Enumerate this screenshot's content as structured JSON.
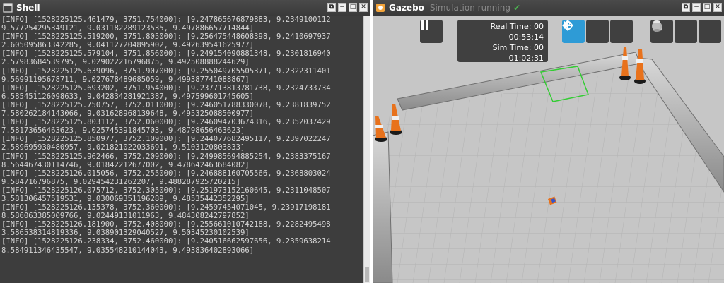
{
  "shell": {
    "title": "Shell",
    "lines": [
      "[INFO] [1528225125.461479, 3751.754000]: [9.247865676879883, 9.2349100112",
      "9.577254295349121, 9.031182289123535, 9.497886657714844]",
      "[INFO] [1528225125.519200, 3751.805000]: [9.256475448608398, 9.2410697937",
      "2.605095863342285, 9.041127204895902, 9.492639541625977]",
      "[INFO] [1528225125.579104, 3751.856000]: [9.249154090881348, 9.2301816940",
      "2.57983684539795, 9.029022216796875, 9.492508888244629]",
      "[INFO] [1528225125.639096, 3751.907000]: [9.255049705505371, 9.2322311401",
      "9.56991195678711, 9.027678489685059, 9.499387741088867]",
      "[INFO] [1528225125.693202, 3751.954000]: [9.237713813781738, 9.2324733734",
      "6.585451126098633, 9.042834281921387, 9.497599601745605]",
      "[INFO] [1528225125.750757, 3752.011000]: [9.246051788330078, 9.2381839752",
      "7.580262184143066, 9.031628968139648, 9.495325088500977]",
      "[INFO] [1528225125.803112, 3752.060000]: [9.246094703674316, 9.2352037429",
      "7.58173656463623, 9.025745391845703, 9.48798656463623]",
      "[INFO] [1528225125.850977, 3752.109000]: [9.244077682495117, 9.2397022247",
      "2.589695930480957, 9.021821022033691, 9.5103120803833]",
      "[INFO] [1528225125.962466, 3752.209000]: [9.249985694885254, 9.2383375167",
      "8.564467430114746, 9.01842212677002, 9.478642463684082]",
      "[INFO] [1528225126.015056, 3752.255000]: [9.246888160705566, 9.2368803024",
      "9.584716796875, 9.029454231262207, 9.488287925720215]",
      "[INFO] [1528225126.075712, 3752.305000]: [9.251973152160645, 9.2311048507",
      "3.581306457519531, 9.030069351196289, 9.48535442352295]",
      "[INFO] [1528225126.135378, 3752.360000]: [9.24597454071045, 9.23917198181",
      "8.586063385009766, 9.02449131011963, 9.484308242797852]",
      "[INFO] [1528225126.181900, 3752.408000]: [9.255661010742188, 9.2282495498",
      "3.586538314819336, 9.038901329040527, 9.50345230102539]",
      "[INFO] [1528225126.238334, 3752.460000]: [9.240516662597656, 9.2359638214",
      "8.584911346435547, 9.035548210144043, 9.493836402893066]"
    ]
  },
  "gazebo": {
    "title": "Gazebo",
    "status": "Simulation running",
    "status_check": "✔",
    "real_time_label": "Real Time: 00",
    "real_time_value": "00:53:14",
    "sim_time_label": "Sim Time: 00",
    "sim_time_value": "01:02:31",
    "colors": {
      "accent": "#2e9bd6",
      "check": "#4caf50",
      "cone": "#e8721c"
    }
  },
  "window_controls": {
    "restore": "⧉",
    "minimize": "−",
    "maximize": "□",
    "close": "✕"
  }
}
